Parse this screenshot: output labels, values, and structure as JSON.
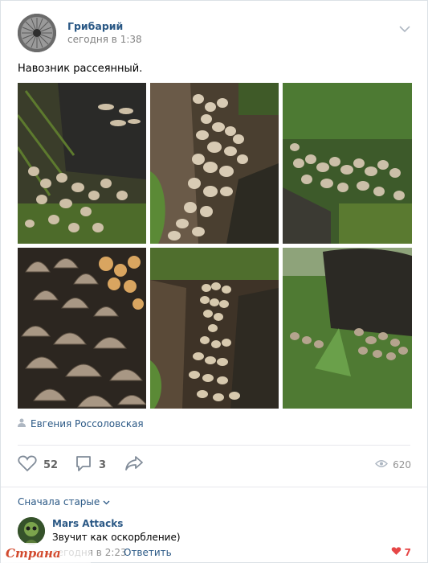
{
  "post": {
    "author": "Грибарий",
    "time": "сегодня в 1:38",
    "text": "Навозник рассеянный.",
    "photo_author": "Евгения Россоловская",
    "likes": "52",
    "comments": "3",
    "views": "620"
  },
  "comments": {
    "sort_label": "Сначала старые",
    "items": [
      {
        "author": "Mars Attacks",
        "text": "Звучит как оскорбление)",
        "time": "сегодня в 2:23",
        "reply_label": "Ответить",
        "likes": "7"
      }
    ]
  },
  "watermark": "Страна Мам",
  "colors": {
    "link": "#2a5885",
    "muted": "#939393",
    "like_active": "#e64646"
  },
  "icons": [
    "chevron-down-icon",
    "user-icon",
    "heart-icon",
    "comment-icon",
    "share-icon",
    "eye-icon"
  ]
}
